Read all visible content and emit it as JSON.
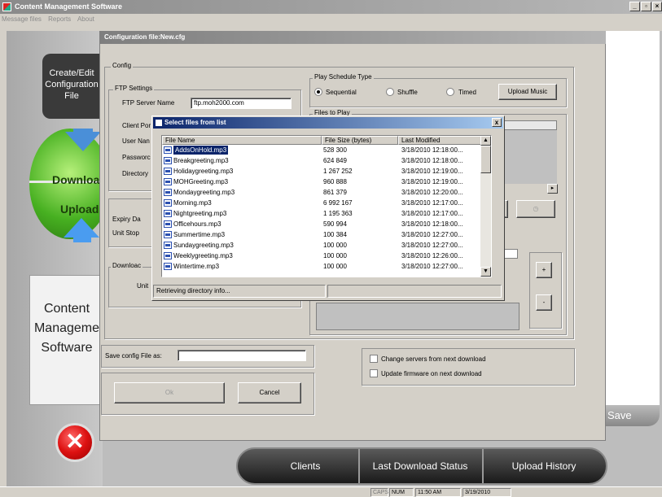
{
  "app": {
    "title": "Content Management Software",
    "menu": [
      "Message files",
      "Reports",
      "About"
    ]
  },
  "left_panel": {
    "create_label": "Create/Edit Configuration File",
    "download_label": "Download",
    "upload_label": "Upload",
    "content_label_1": "Content",
    "content_label_2": "Manageme",
    "content_label_3": "Software"
  },
  "bottom_nav": {
    "clients": "Clients",
    "last_download_status": "Last Download Status",
    "upload_history": "Upload History"
  },
  "right_panel": {
    "save_label": "Save"
  },
  "config": {
    "window_title": "Configuration file:New.cfg",
    "config_group": "Config",
    "ftp_group": "FTP Settings",
    "ftp_server_label": "FTP Server Name",
    "ftp_server_value": "ftp.moh2000.com",
    "client_port_label": "Client Por",
    "user_name_label": "User Nan",
    "password_label": "Passworc",
    "directory_label": "Directory",
    "expiry_label": "Expiry Da",
    "unit_stop_label": "Unit Stop",
    "download_group": "Downloac",
    "unit_label": "Unit",
    "play_schedule_group": "Play Schedule Type",
    "sequential": "Sequential",
    "shuffle": "Shuffle",
    "timed": "Timed",
    "upload_music": "Upload Music",
    "files_to_play": "Files to Play",
    "plus": "+",
    "minus": "-",
    "save_config_label": "Save config File as:",
    "save_config_value": "",
    "ok": "Ok",
    "cancel": "Cancel",
    "change_servers": "Change servers from next download",
    "update_firmware": "Update firmware on next download"
  },
  "dialog": {
    "title": "Select files from list",
    "close": "x",
    "columns": [
      "File Name",
      "File Size (bytes)",
      "Last Modified"
    ],
    "rows": [
      [
        "AddsOnHold.mp3",
        "528 300",
        "3/18/2010 12:18:00..."
      ],
      [
        "Breakgreeting.mp3",
        "624 849",
        "3/18/2010 12:18:00..."
      ],
      [
        "Holidaygreeting.mp3",
        "1 267 252",
        "3/18/2010 12:19:00..."
      ],
      [
        "MOHGreeting.mp3",
        "960 888",
        "3/18/2010 12:19:00..."
      ],
      [
        "Mondaygreeting.mp3",
        "861 379",
        "3/18/2010 12:20:00..."
      ],
      [
        "Morning.mp3",
        "6 992 167",
        "3/18/2010 12:17:00..."
      ],
      [
        "Nightgreeting.mp3",
        "1 195 363",
        "3/18/2010 12:17:00..."
      ],
      [
        "Officehours.mp3",
        "590 994",
        "3/18/2010 12:18:00..."
      ],
      [
        "Summertime.mp3",
        "100 384",
        "3/18/2010 12:27:00..."
      ],
      [
        "Sundaygreeting.mp3",
        "100 000",
        "3/18/2010 12:27:00..."
      ],
      [
        "Weeklygreeting.mp3",
        "100 000",
        "3/18/2010 12:26:00..."
      ],
      [
        "Wintertime.mp3",
        "100 000",
        "3/18/2010 12:27:00..."
      ]
    ],
    "status": "Retrieving directory info..."
  },
  "status_bar": {
    "caps": "CAPS",
    "num": "NUM",
    "time": "11:50 AM",
    "date": "3/19/2010"
  }
}
